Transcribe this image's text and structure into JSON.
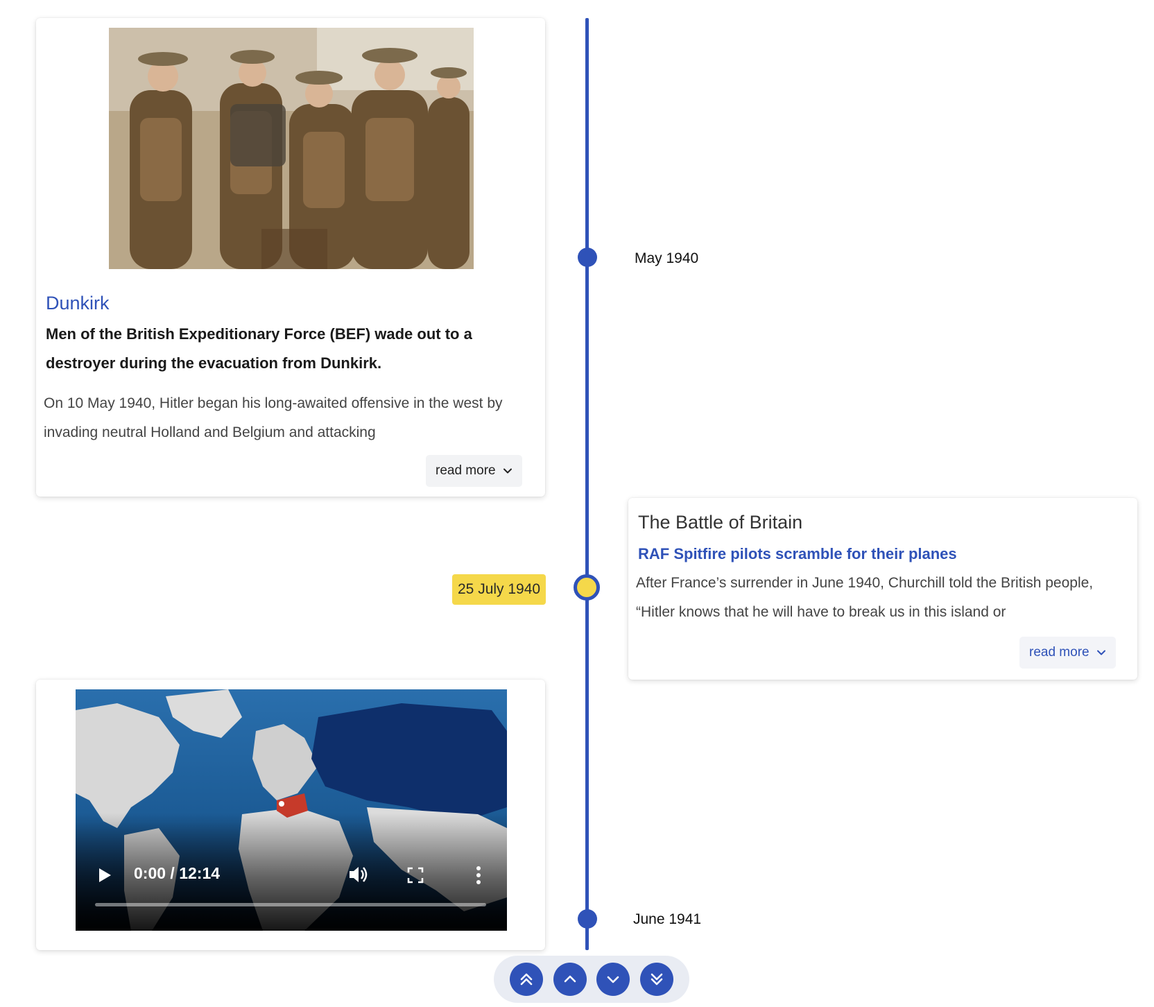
{
  "timeline": {
    "events": [
      {
        "date": "May 1940"
      },
      {
        "date": "25 July 1940"
      },
      {
        "date": "June 1941"
      }
    ]
  },
  "cards": {
    "dunkirk": {
      "title": "Dunkirk",
      "subtitle": "Men of the British Expeditionary Force (BEF) wade out to a destroyer during the evacuation from Dunkirk.",
      "body": "On 10 May 1940, Hitler began his long-awaited offensive in the west by invading neutral Holland and Belgium and attacking",
      "read_more": "read more"
    },
    "battle_of_britain": {
      "title": "The Battle of Britain",
      "subtitle": "RAF Spitfire pilots scramble for their planes",
      "body": "After France’s surrender in June 1940, Churchill told the British people, “Hitler knows that he will have to break us in this island or",
      "read_more": "read more"
    },
    "video": {
      "time": "0:00 / 12:14",
      "progress": 0
    }
  },
  "colors": {
    "accent": "#2f52b8",
    "highlight": "#f5d84a"
  },
  "icons": {
    "nav": [
      "double-chevron-up-icon",
      "chevron-up-icon",
      "chevron-down-icon",
      "double-chevron-down-icon"
    ],
    "video": [
      "play-icon",
      "volume-icon",
      "fullscreen-icon",
      "more-vertical-icon"
    ]
  }
}
